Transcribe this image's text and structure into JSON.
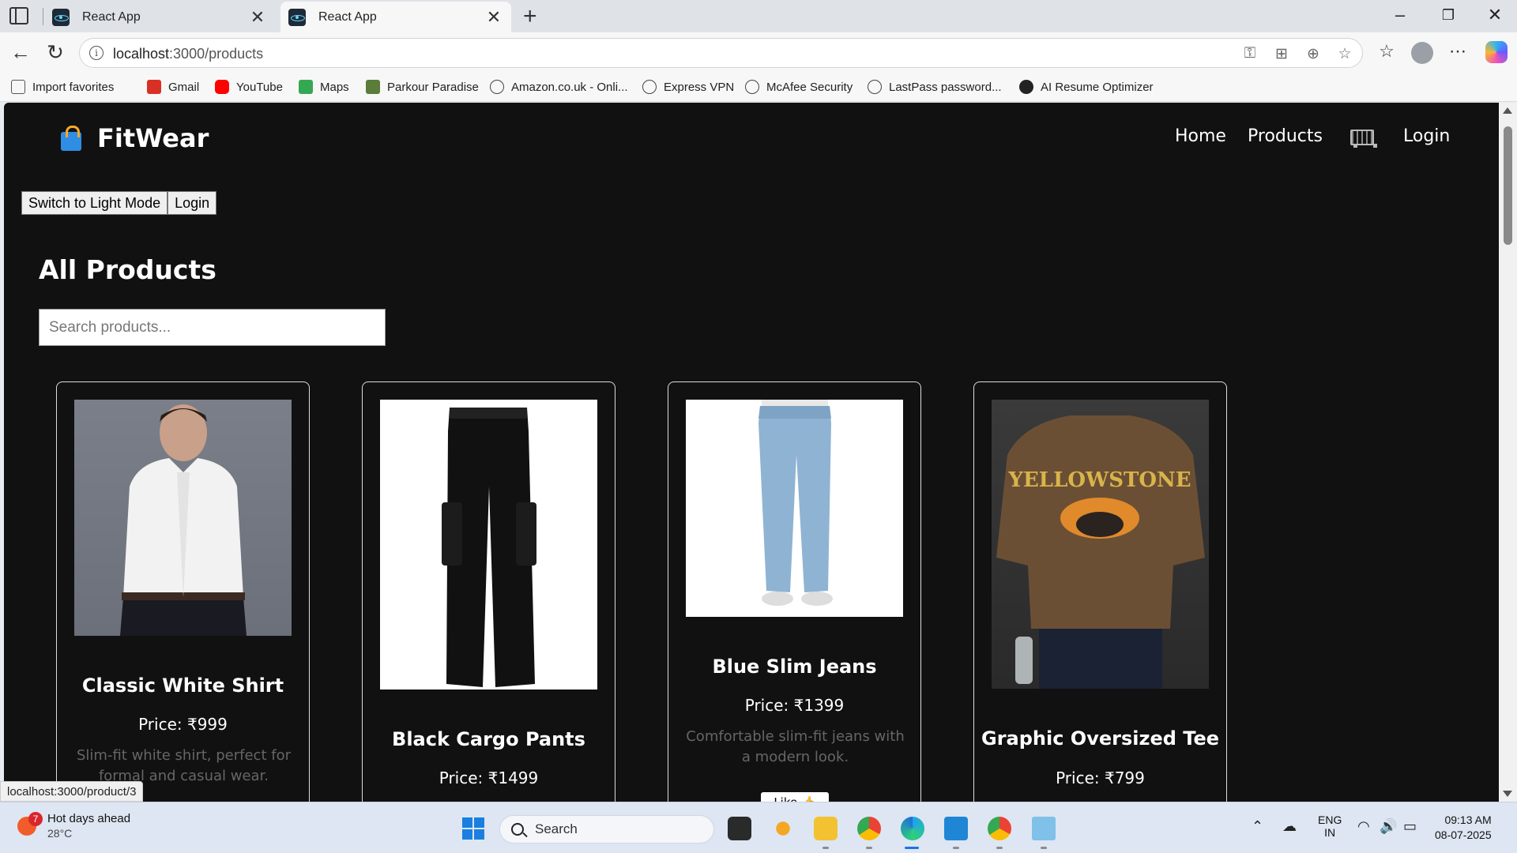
{
  "browser": {
    "tabs": [
      {
        "title": "React App"
      },
      {
        "title": "React App"
      }
    ],
    "address": {
      "host": "localhost",
      "path": ":3000/products"
    },
    "bookmarks": [
      {
        "label": "Import favorites",
        "color": "#555555"
      },
      {
        "label": "Gmail",
        "color": "#d93025"
      },
      {
        "label": "YouTube",
        "color": "#ff0000"
      },
      {
        "label": "Maps",
        "color": "#34a853"
      },
      {
        "label": "Parkour Paradise",
        "color": "#5a7d3a"
      },
      {
        "label": "Amazon.co.uk - Onli...",
        "color": "#444444"
      },
      {
        "label": "Express VPN",
        "color": "#444444"
      },
      {
        "label": "McAfee Security",
        "color": "#444444"
      },
      {
        "label": "LastPass password...",
        "color": "#444444"
      },
      {
        "label": "AI Resume Optimizer",
        "color": "#222222"
      }
    ],
    "status_url": "localhost:3000/product/3"
  },
  "site": {
    "brand": "FitWear",
    "nav": {
      "home": "Home",
      "products": "Products",
      "login": "Login"
    },
    "theme_button": "Switch to Light Mode",
    "login_button": "Login",
    "page_title": "All Products",
    "search_placeholder": "Search products...",
    "products": [
      {
        "name": "Classic White Shirt",
        "price": "Price: ₹999",
        "description": "Slim-fit white shirt, perfect for formal and casual wear."
      },
      {
        "name": "Black Cargo Pants",
        "price": "Price: ₹1499"
      },
      {
        "name": "Blue Slim Jeans",
        "price": "Price: ₹1399",
        "description": "Comfortable slim-fit jeans with a modern look.",
        "like_label": "Like 👍"
      },
      {
        "name": "Graphic Oversized Tee",
        "price": "Price: ₹799",
        "print_text": "YELLOWSTONE"
      }
    ]
  },
  "taskbar": {
    "weather_title": "Hot days ahead",
    "weather_temp": "28°C",
    "weather_badge": "7",
    "search_label": "Search",
    "lang_top": "ENG",
    "lang_bottom": "IN",
    "time": "09:13 AM",
    "date": "08-07-2025"
  },
  "colors": {
    "page_bg": "#111111",
    "accent_link": "#ffffff"
  }
}
